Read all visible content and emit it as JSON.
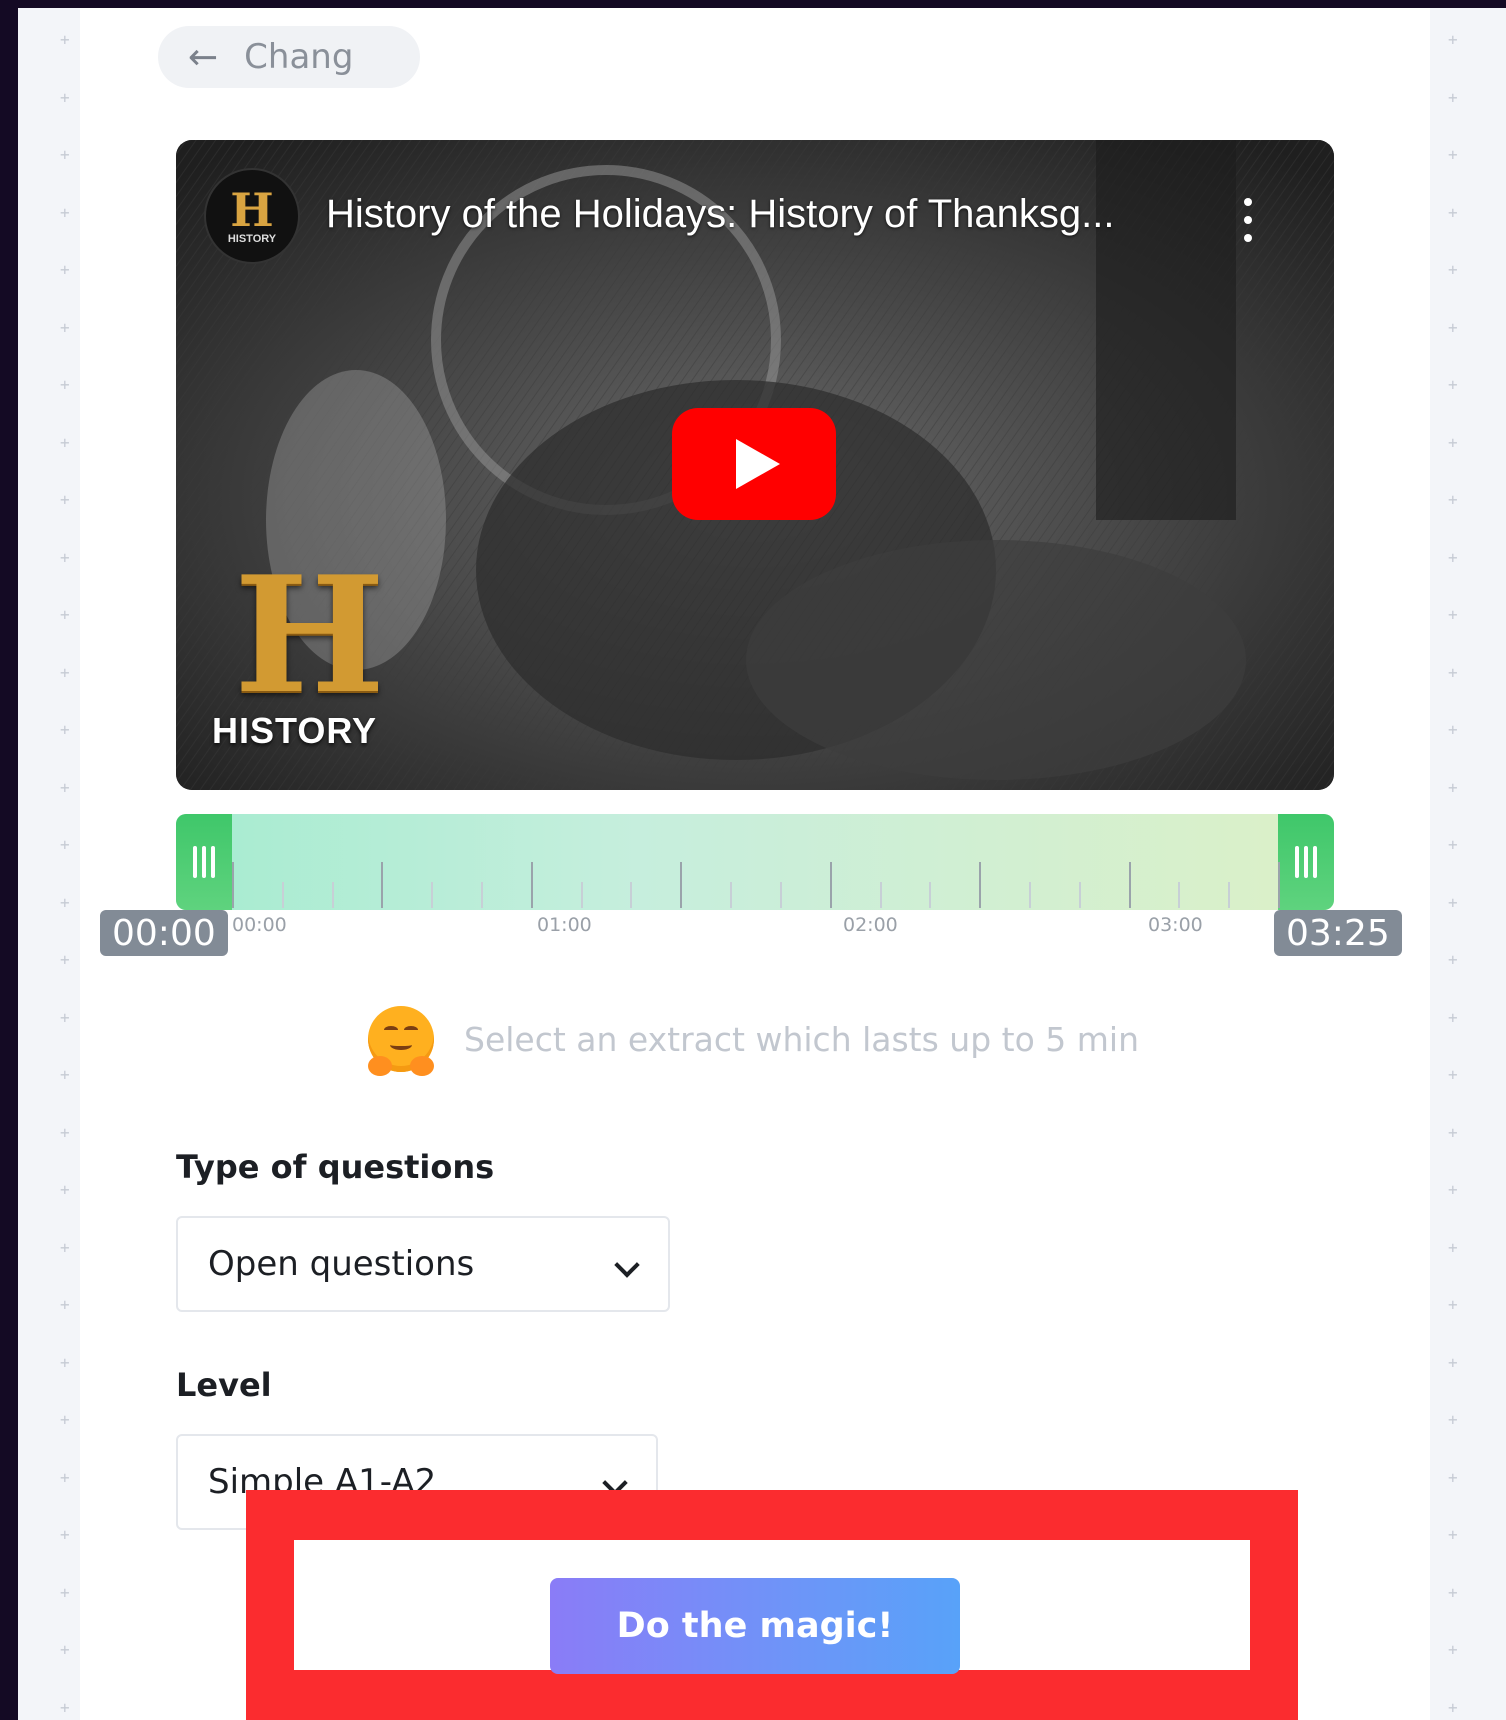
{
  "back_button": {
    "label": "Chang"
  },
  "video": {
    "title": "History of the Holidays: History of Thanksg...",
    "channel_logo_text": "HISTORY",
    "watermark_word": "HISTORY"
  },
  "timeline": {
    "start_badge": "00:00",
    "end_badge": "03:25",
    "tick_labels": [
      "00:00",
      "01:00",
      "02:00",
      "03:00"
    ],
    "selection_start_fraction": 0.0,
    "selection_end_fraction": 1.0
  },
  "hint": {
    "text": "Select an extract which lasts up to 5 min"
  },
  "form": {
    "question_type_label": "Type of questions",
    "question_type_value": "Open questions",
    "level_label": "Level",
    "level_value": "Simple A1-A2"
  },
  "cta": {
    "label": "Do the magic!"
  },
  "colors": {
    "accent_gradient_start": "#8a7cf7",
    "accent_gradient_end": "#58a2f9",
    "handle_green": "#4fcf6e",
    "highlight_red": "#fb2c2f",
    "youtube_red": "#ff0000"
  }
}
